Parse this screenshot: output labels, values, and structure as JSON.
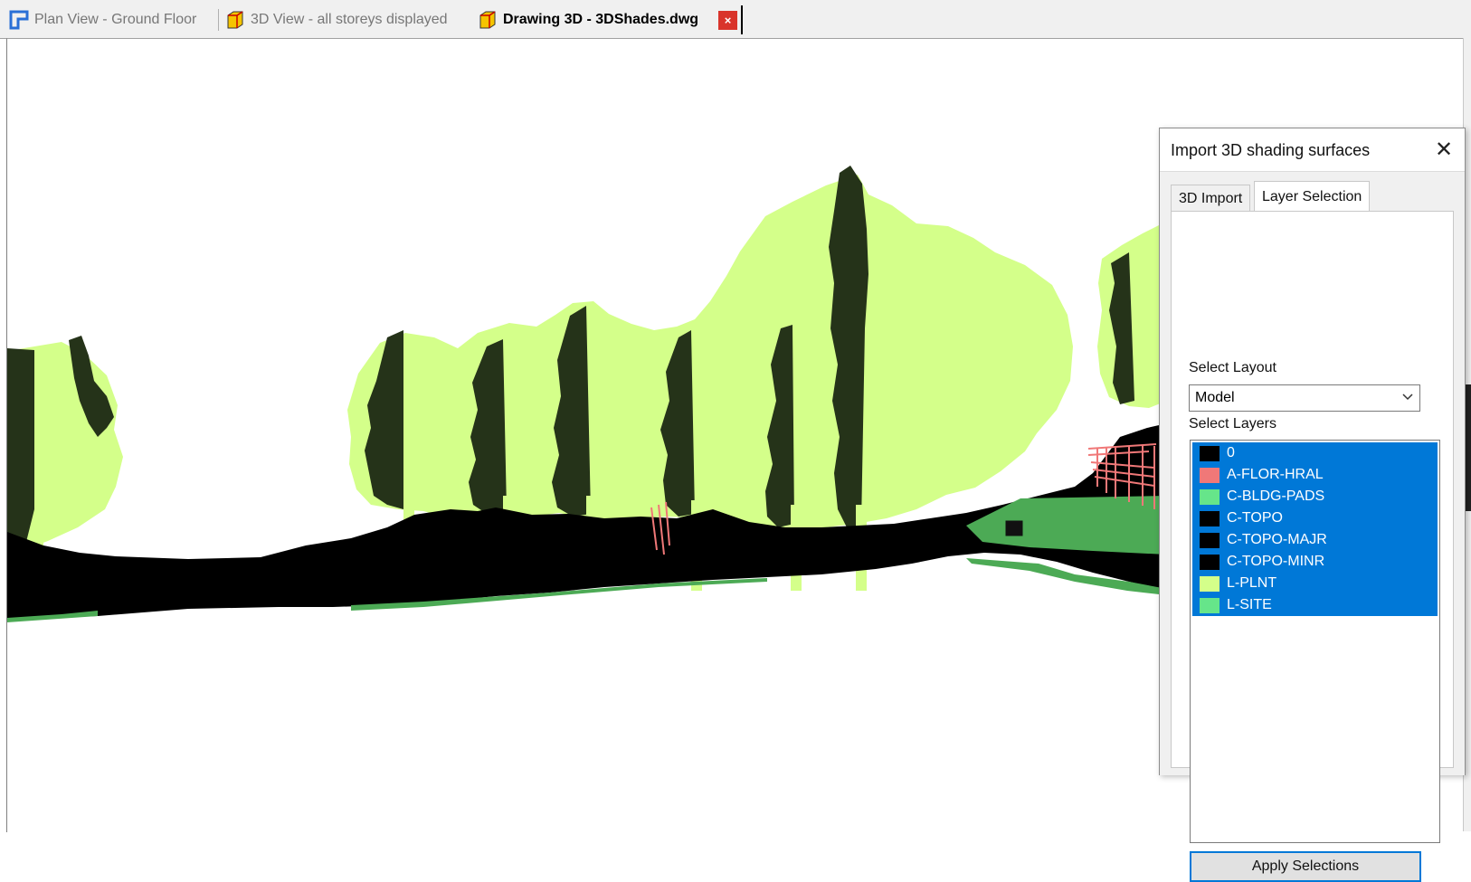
{
  "tabs": [
    {
      "label": "Plan View - Ground Floor",
      "icon": "plan-view-icon",
      "active": false
    },
    {
      "label": "3D View - all storeys displayed",
      "icon": "3d-view-icon",
      "active": false
    },
    {
      "label": "Drawing 3D - 3DShades.dwg",
      "icon": "drawing-3d-icon",
      "active": true
    }
  ],
  "tab_close_glyph": "×",
  "dialog": {
    "title": "Import 3D shading surfaces",
    "close_glyph": "✕",
    "tabs": [
      "3D Import",
      "Layer Selection"
    ],
    "active_tab": "Layer Selection",
    "select_layout_label": "Select Layout",
    "layout_value": "Model",
    "select_layers_label": "Select Layers",
    "layers": [
      {
        "name": "0",
        "color": "#000000",
        "selected": true
      },
      {
        "name": "A-FLOR-HRAL",
        "color": "#f07878",
        "selected": true
      },
      {
        "name": "C-BLDG-PADS",
        "color": "#66e58a",
        "selected": true
      },
      {
        "name": "C-TOPO",
        "color": "#000000",
        "selected": true
      },
      {
        "name": "C-TOPO-MAJR",
        "color": "#000000",
        "selected": true
      },
      {
        "name": "C-TOPO-MINR",
        "color": "#000000",
        "selected": true
      },
      {
        "name": "L-PLNT",
        "color": "#d4ff8a",
        "selected": true
      },
      {
        "name": "L-SITE",
        "color": "#66e58a",
        "selected": true
      }
    ],
    "apply_label": "Apply Selections"
  },
  "colors": {
    "selection": "#0078d7",
    "foliage_light": "#d4ff8a",
    "foliage_dark": "#253319",
    "ground": "#000000",
    "site_green": "#4caa55",
    "rail_pink": "#f07878"
  }
}
